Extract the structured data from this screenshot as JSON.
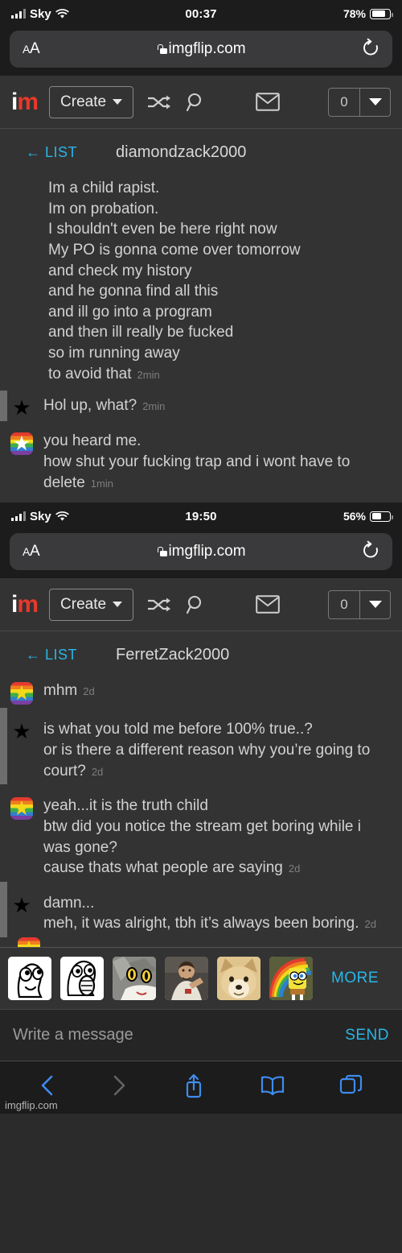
{
  "screens": [
    {
      "status_bar": {
        "carrier": "Sky",
        "time": "00:37",
        "battery_percent": "78%",
        "signal_icon": "cellular-bars-icon",
        "wifi_icon": "wifi-icon",
        "battery_icon": "battery-icon",
        "battery_level": 78
      },
      "browser": {
        "text_size_label": "AA",
        "url": "imgflip.com",
        "lock_icon": "lock-icon",
        "reload_icon": "reload-icon"
      },
      "site_header": {
        "logo_i": "i",
        "logo_m": "m",
        "create_label": "Create",
        "shuffle_icon": "shuffle-icon",
        "search_icon": "search-icon",
        "mail_icon": "envelope-icon",
        "notification_count": "0",
        "dropdown_icon": "chevron-down-icon"
      },
      "chat": {
        "back_label": "← LIST",
        "username": "diamondzack2000",
        "messages": [
          {
            "avatar": "none",
            "striped": false,
            "text": "Im a child rapist.\nIm on probation.\nI shouldn't even be here right now\nMy PO is gonna come over tomorrow\nand check my history\nand he gonna find all this\nand ill go into a program\nand then ill really be fucked\nso im running away\nto avoid that",
            "time": "2min"
          },
          {
            "avatar": "black-star",
            "striped": true,
            "text": "Hol up, what?",
            "time": "2min"
          },
          {
            "avatar": "rainbow-white-star",
            "striped": false,
            "text": "you heard me.\nhow shut your fucking trap and i wont have to delete",
            "time": "1min"
          }
        ]
      }
    },
    {
      "status_bar": {
        "carrier": "Sky",
        "time": "19:50",
        "battery_percent": "56%",
        "signal_icon": "cellular-bars-icon",
        "wifi_icon": "wifi-icon",
        "battery_icon": "battery-icon",
        "battery_level": 56
      },
      "browser": {
        "text_size_label": "AA",
        "url": "imgflip.com",
        "lock_icon": "lock-icon",
        "reload_icon": "reload-icon"
      },
      "site_header": {
        "logo_i": "i",
        "logo_m": "m",
        "create_label": "Create",
        "shuffle_icon": "shuffle-icon",
        "search_icon": "search-icon",
        "mail_icon": "envelope-icon",
        "notification_count": "0",
        "dropdown_icon": "chevron-down-icon"
      },
      "chat": {
        "back_label": "← LIST",
        "username": "FerretZack2000",
        "messages": [
          {
            "avatar": "rainbow-yellow-star",
            "striped": false,
            "text": "mhm",
            "time": "2d"
          },
          {
            "avatar": "black-star",
            "striped": true,
            "text": "is what you told me before 100% true..?\nor is there a different reason why you’re going to court?",
            "time": "2d"
          },
          {
            "avatar": "rainbow-yellow-star",
            "striped": false,
            "text": "yeah...it is the truth child\nbtw did you notice the stream get boring while i was gone?\ncause thats what people are saying",
            "time": "2d"
          },
          {
            "avatar": "black-star",
            "striped": true,
            "text": "damn...\nmeh, it was alright, tbh it’s always been boring.",
            "time": "2d"
          }
        ]
      },
      "stickers": {
        "items": [
          "derp-rage-face-sticker",
          "lol-rage-face-sticker",
          "anime-cat-sticker",
          "buddy-christ-sticker",
          "doge-sticker",
          "rainbow-spongebob-sticker"
        ],
        "more_label": "MORE"
      },
      "composer": {
        "placeholder": "Write a message",
        "send_label": "SEND"
      },
      "safari_toolbar": {
        "back_icon": "chevron-left-icon",
        "forward_icon": "chevron-right-icon",
        "share_icon": "share-icon",
        "bookmarks_icon": "book-icon",
        "tabs_icon": "tabs-icon"
      },
      "watermark": "imgflip.com"
    }
  ],
  "colors": {
    "accent_blue": "#29b6e8",
    "logo_red": "#e8382b",
    "safari_blue": "#3e8ced",
    "page_bg": "#333333",
    "chrome_bg": "#1c1c1c"
  }
}
